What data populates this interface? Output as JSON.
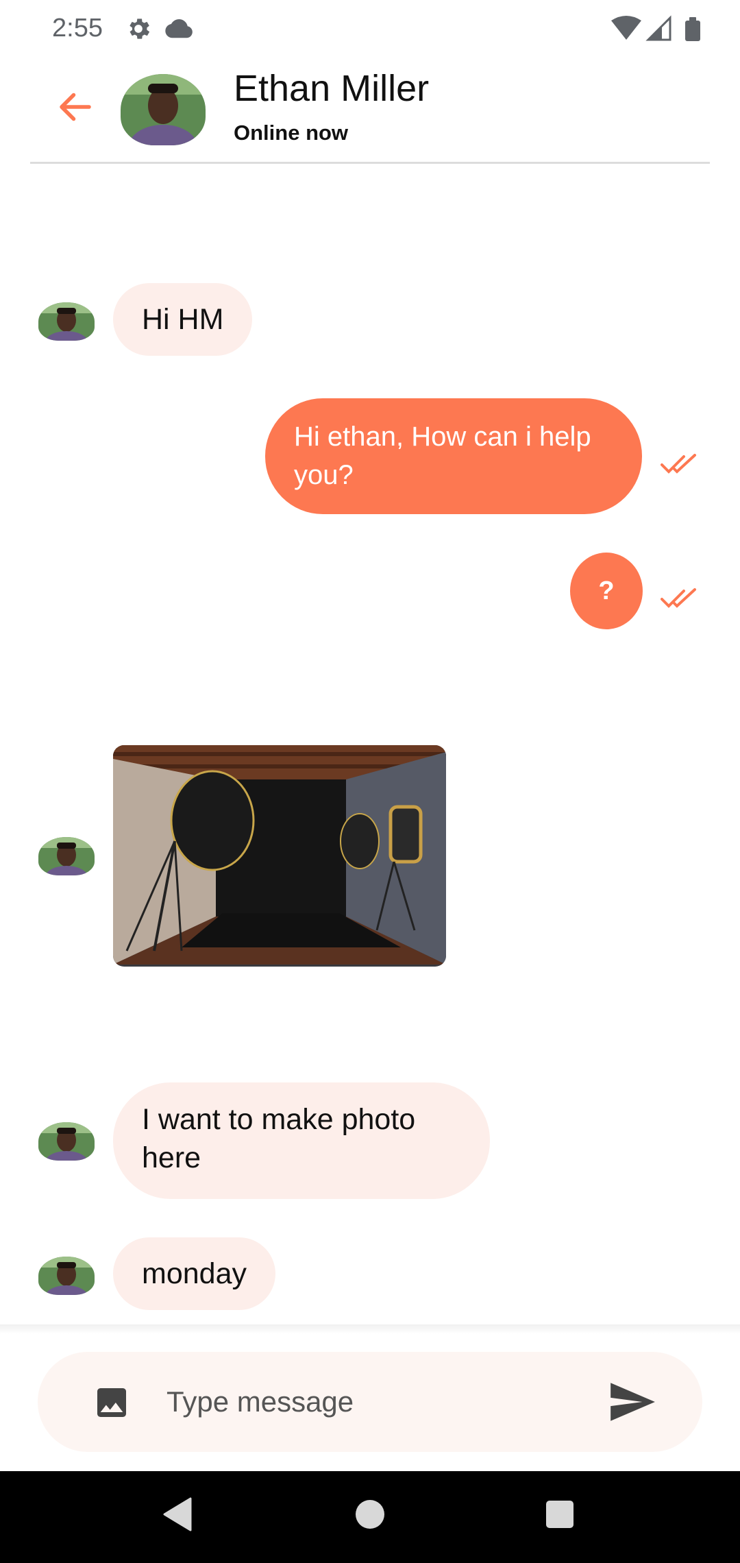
{
  "status_bar": {
    "time": "2:55",
    "icons": [
      "settings-gear-icon",
      "cloud-icon",
      "wifi-icon",
      "cell-signal-icon",
      "battery-icon"
    ]
  },
  "header": {
    "contact_name": "Ethan Miller",
    "contact_status": "Online now"
  },
  "messages": [
    {
      "direction": "incoming",
      "type": "text",
      "text": "Hi HM"
    },
    {
      "direction": "outgoing",
      "type": "text",
      "text": "Hi ethan, How can i help you?",
      "status": "read"
    },
    {
      "direction": "outgoing",
      "type": "text",
      "text": "?",
      "status": "read"
    },
    {
      "direction": "incoming",
      "type": "image",
      "image": "photo-studio-image"
    },
    {
      "direction": "incoming",
      "type": "text",
      "text": "I want to make photo here"
    },
    {
      "direction": "incoming",
      "type": "text",
      "text": "monday"
    }
  ],
  "composer": {
    "placeholder": "Type message"
  },
  "colors": {
    "accent": "#FD7851",
    "incoming_bubble": "#FDEEEA",
    "composer_bg": "#FDF5F2"
  }
}
